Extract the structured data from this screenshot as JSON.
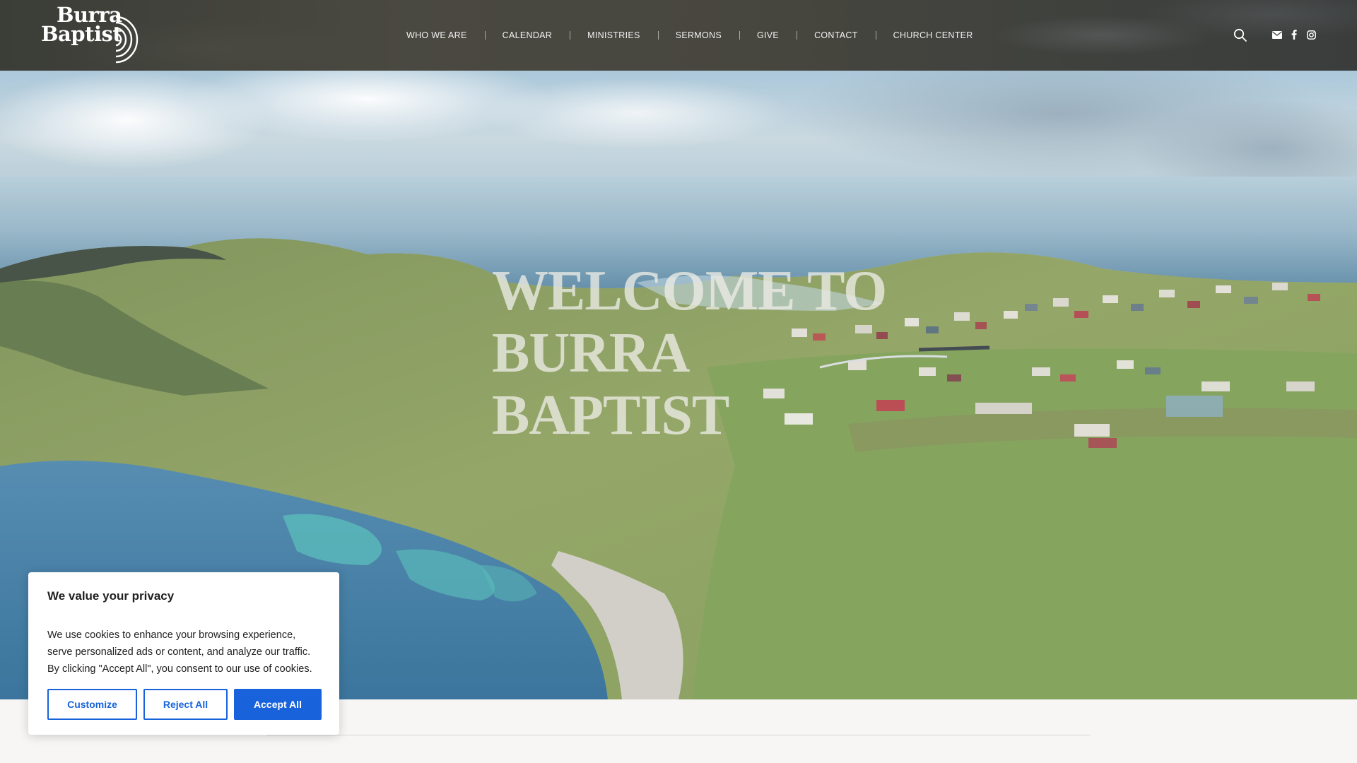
{
  "header": {
    "logo": {
      "line1": "Burra",
      "line2": "Baptist"
    },
    "nav": [
      "WHO WE ARE",
      "CALENDAR",
      "MINISTRIES",
      "SERMONS",
      "GIVE",
      "CONTACT",
      "CHURCH CENTER"
    ],
    "icons": [
      "search-icon",
      "envelope-icon",
      "facebook-icon",
      "instagram-icon"
    ]
  },
  "hero": {
    "title_lines": [
      "WELCOME TO",
      "BURRA",
      "BAPTIST"
    ]
  },
  "cookie": {
    "title": "We value your privacy",
    "body": "We use cookies to enhance your browsing experience, serve personalized ads or content, and analyze our traffic. By clicking \"Accept All\", you consent to our use of cookies.",
    "customize": "Customize",
    "reject": "Reject All",
    "accept": "Accept All",
    "accent": "#1863dc"
  }
}
